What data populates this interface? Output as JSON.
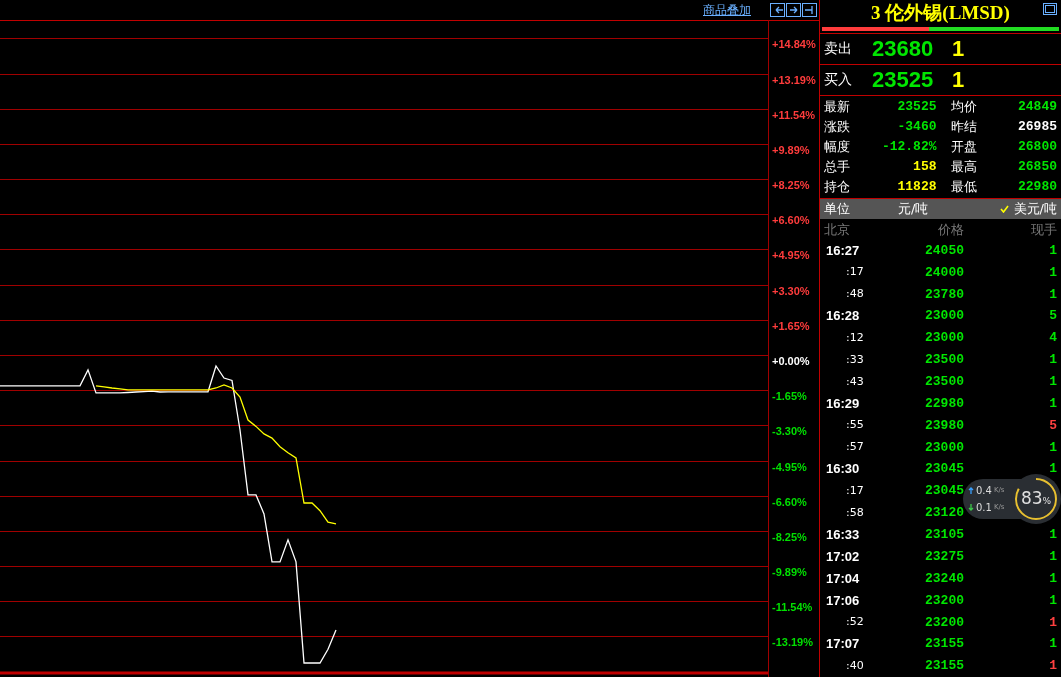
{
  "toolbar": {
    "overlay_link": "商品叠加",
    "buttons": [
      {
        "kind": "left"
      },
      {
        "kind": "right"
      },
      {
        "kind": "panel"
      }
    ]
  },
  "chart": {
    "chart_data": {
      "type": "line",
      "ylim": [
        -14.91,
        15.7
      ],
      "grid": true,
      "yticks": [
        {
          "value": 14.84,
          "label": "+14.84%"
        },
        {
          "value": 13.19,
          "label": "+13.19%"
        },
        {
          "value": 11.54,
          "label": "+11.54%"
        },
        {
          "value": 9.89,
          "label": "+9.89%"
        },
        {
          "value": 8.25,
          "label": "+8.25%"
        },
        {
          "value": 6.6,
          "label": "+6.60%"
        },
        {
          "value": 4.95,
          "label": "+4.95%"
        },
        {
          "value": 3.3,
          "label": "+3.30%"
        },
        {
          "value": 1.65,
          "label": "+1.65%"
        },
        {
          "value": 0,
          "label": "+0.00%"
        },
        {
          "value": -1.65,
          "label": "-1.65%"
        },
        {
          "value": -3.3,
          "label": "-3.30%"
        },
        {
          "value": -4.95,
          "label": "-4.95%"
        },
        {
          "value": -6.6,
          "label": "-6.60%"
        },
        {
          "value": -8.25,
          "label": "-8.25%"
        },
        {
          "value": -9.89,
          "label": "-9.89%"
        },
        {
          "value": -11.54,
          "label": "-11.54%"
        },
        {
          "value": -13.19,
          "label": "-13.19%"
        }
      ],
      "categories": [
        null,
        null,
        null,
        null,
        null,
        null,
        null,
        null,
        null,
        null,
        null,
        null,
        null,
        null,
        null,
        null,
        null,
        null,
        null,
        null,
        null,
        null,
        null,
        null,
        null,
        null,
        null,
        null,
        null,
        null,
        null,
        null,
        null,
        null,
        null,
        null,
        null,
        null,
        null,
        null,
        null,
        null,
        null,
        null,
        null,
        null,
        null,
        null,
        null,
        null,
        null,
        null,
        null,
        null,
        null,
        null,
        null,
        null,
        null,
        null,
        null,
        null,
        null,
        null,
        null,
        null,
        null,
        null,
        null,
        null,
        null,
        null,
        null,
        null,
        null,
        null,
        null,
        null,
        null,
        null,
        null,
        null,
        null,
        null,
        null,
        null,
        null,
        null,
        null,
        null,
        null,
        null,
        null,
        null,
        null,
        null,
        null
      ],
      "series": [
        {
          "color": "#ffffff",
          "values": [
            -1.45,
            -1.45,
            -1.45,
            -1.45,
            -1.45,
            -1.45,
            -1.45,
            -1.45,
            -1.45,
            -1.45,
            -1.45,
            -0.7,
            -1.78,
            -1.78,
            -1.78,
            -1.78,
            -1.76,
            -1.74,
            -1.72,
            -1.7,
            -1.74,
            -1.73,
            -1.73,
            -1.73,
            -1.73,
            -1.73,
            -1.73,
            -0.52,
            -1.08,
            -1.2,
            -3.52,
            -6.56,
            -6.56,
            -7.45,
            -9.7,
            -9.7,
            -8.67,
            -9.7,
            -14.44,
            -14.44,
            -14.44,
            -13.8,
            -12.89,
            null,
            null,
            null,
            null,
            null,
            null,
            null,
            null,
            null,
            null,
            null,
            null,
            null,
            null,
            null,
            null,
            null,
            null,
            null,
            null,
            null,
            null,
            null,
            null,
            null,
            null,
            null,
            null,
            null,
            null,
            null,
            null,
            null,
            null,
            null,
            null,
            null,
            null,
            null,
            null,
            null,
            null,
            null,
            null,
            null,
            null,
            null,
            null,
            null,
            null,
            null,
            null,
            null,
            null
          ]
        },
        {
          "color": "#ffff00",
          "values": [
            null,
            null,
            null,
            null,
            null,
            null,
            null,
            null,
            null,
            null,
            null,
            null,
            -1.45,
            -1.5,
            -1.55,
            -1.59,
            -1.64,
            -1.64,
            -1.64,
            -1.64,
            -1.64,
            -1.64,
            -1.64,
            -1.64,
            -1.64,
            -1.64,
            -1.64,
            -1.55,
            -1.41,
            -1.55,
            -1.97,
            -3.05,
            -3.35,
            -3.7,
            -3.9,
            -4.3,
            -4.59,
            -4.83,
            -6.94,
            -6.94,
            -7.3,
            -7.84,
            -7.92,
            null,
            null,
            null,
            null,
            null,
            null,
            null,
            null,
            null,
            null,
            null,
            null,
            null,
            null,
            null,
            null,
            null,
            null,
            null,
            null,
            null,
            null,
            null,
            null,
            null,
            null,
            null,
            null,
            null,
            null,
            null,
            null,
            null,
            null,
            null,
            null,
            null,
            null,
            null,
            null,
            null,
            null,
            null,
            null,
            null,
            null,
            null,
            null,
            null,
            null,
            null,
            null,
            null,
            null
          ]
        }
      ]
    }
  },
  "quote": {
    "title": "3 伦外锡(LMSD)",
    "ratio_bar": {
      "level": 0.45
    },
    "sell": {
      "label": "卖出",
      "price": "23680",
      "volume": "1"
    },
    "buy": {
      "label": "买入",
      "price": "23525",
      "volume": "1"
    },
    "stats": [
      {
        "label": "最新",
        "value": "23525",
        "color": "#00e600"
      },
      {
        "label": "均价",
        "value": "24849",
        "color": "#00e600"
      },
      {
        "label": "涨跌",
        "value": "-3460",
        "color": "#00e600"
      },
      {
        "label": "昨结",
        "value": "26985",
        "color": "#ffffff"
      },
      {
        "label": "幅度",
        "value": "-12.82%",
        "color": "#00e600"
      },
      {
        "label": "开盘",
        "value": "26800",
        "color": "#00e600"
      },
      {
        "label": "总手",
        "value": "158",
        "color": "#ffff00"
      },
      {
        "label": "最高",
        "value": "26850",
        "color": "#00e600"
      },
      {
        "label": "持仓",
        "value": "11828",
        "color": "#ffff00"
      },
      {
        "label": "最低",
        "value": "22980",
        "color": "#00e600"
      }
    ],
    "unit": {
      "label": "单位",
      "value": "元/吨",
      "usd_checkbox": {
        "label": "美元/吨",
        "checked": true
      }
    },
    "ticks": {
      "columns": [
        "北京",
        "价格",
        "现手"
      ],
      "rows": [
        {
          "kind": "minute",
          "time": "16:27",
          "price": "24050",
          "volume": "1",
          "color": "#00e600"
        },
        {
          "kind": "second",
          "time": ":17",
          "price": "24000",
          "volume": "1",
          "color": "#00e600"
        },
        {
          "kind": "second",
          "time": ":48",
          "price": "23780",
          "volume": "1",
          "color": "#00e600"
        },
        {
          "kind": "minute",
          "time": "16:28",
          "price": "23000",
          "volume": "5",
          "color": "#00e600"
        },
        {
          "kind": "second",
          "time": ":12",
          "price": "23000",
          "volume": "4",
          "color": "#00e600"
        },
        {
          "kind": "second",
          "time": ":33",
          "price": "23500",
          "volume": "1",
          "color": "#00e600"
        },
        {
          "kind": "second",
          "time": ":43",
          "price": "23500",
          "volume": "1",
          "color": "#00e600"
        },
        {
          "kind": "minute",
          "time": "16:29",
          "price": "22980",
          "volume": "1",
          "color": "#00e600"
        },
        {
          "kind": "second",
          "time": ":55",
          "price": "23980",
          "volume": "5",
          "color": "#ff4040"
        },
        {
          "kind": "second",
          "time": ":57",
          "price": "23000",
          "volume": "1",
          "color": "#00e600"
        },
        {
          "kind": "minute",
          "time": "16:30",
          "price": "23045",
          "volume": "1",
          "color": "#00e600"
        },
        {
          "kind": "second",
          "time": ":17",
          "price": "23045"
        },
        {
          "kind": "second",
          "time": ":58",
          "price": "23120"
        },
        {
          "kind": "minute",
          "time": "16:33",
          "price": "23105",
          "volume": "1",
          "color": "#00e600"
        },
        {
          "kind": "minute",
          "time": "17:02",
          "price": "23275",
          "volume": "1",
          "color": "#00e600"
        },
        {
          "kind": "minute",
          "time": "17:04",
          "price": "23240",
          "volume": "1",
          "color": "#00e600"
        },
        {
          "kind": "minute",
          "time": "17:06",
          "price": "23200",
          "volume": "1",
          "color": "#00e600"
        },
        {
          "kind": "second",
          "time": ":52",
          "price": "23200",
          "volume": "1",
          "color": "#ff4040"
        },
        {
          "kind": "minute",
          "time": "17:07",
          "price": "23155",
          "volume": "1",
          "color": "#00e600"
        },
        {
          "kind": "second",
          "time": ":40",
          "price": "23155",
          "volume": "1",
          "color": "#ff4040"
        }
      ]
    }
  },
  "network_widget": {
    "upload": "0.4",
    "upload_unit": "K/s",
    "download": "0.1",
    "download_unit": "K/s",
    "percent": "83",
    "percent_sign": "%"
  }
}
